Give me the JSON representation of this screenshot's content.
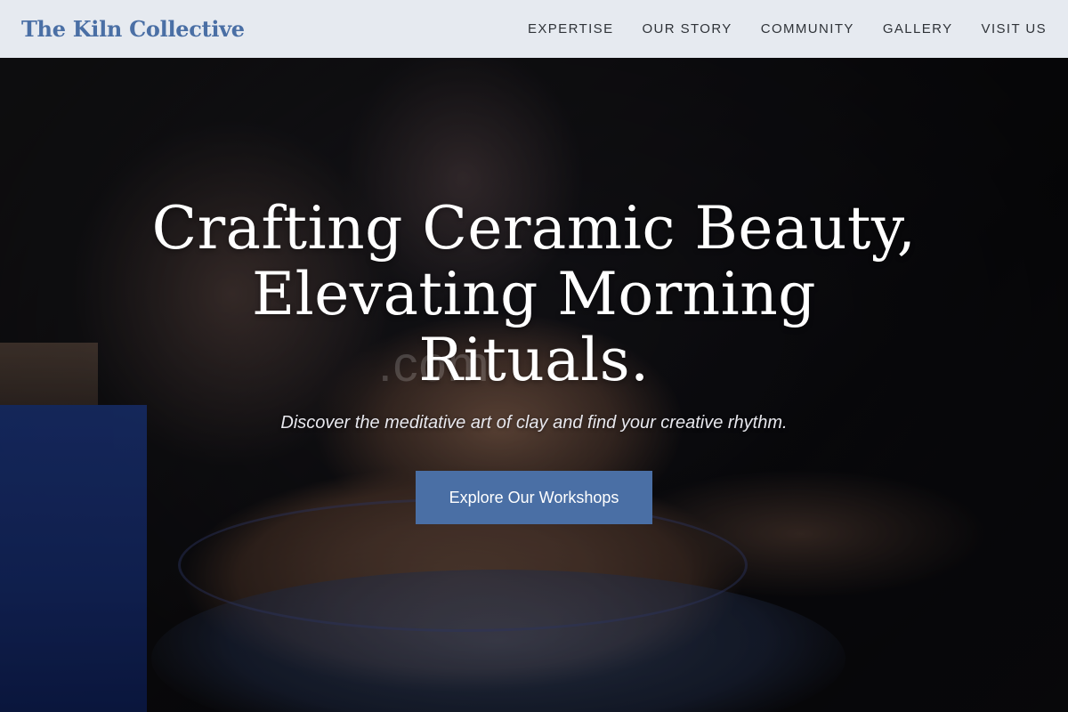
{
  "nav": {
    "brand": "The Kiln Collective",
    "links": [
      {
        "label": "EXPERTISE"
      },
      {
        "label": "OUR STORY"
      },
      {
        "label": "COMMUNITY"
      },
      {
        "label": "GALLERY"
      },
      {
        "label": "VISIT US"
      }
    ]
  },
  "hero": {
    "title_lines": [
      "Crafting Ceramic Beauty,",
      "Elevating Morning",
      "Rituals."
    ],
    "subtitle": "Discover the meditative art of clay and find your creative rhythm.",
    "cta_label": "Explore Our Workshops",
    "background_image": "pottery-wheel-hands-photo",
    "watermark": ".com"
  },
  "colors": {
    "brand": "#4a6fa5",
    "nav_bg": "#e6eaf0",
    "nav_text": "#2f3338",
    "hero_text": "#ffffff",
    "cta_bg": "#4a6fa5"
  }
}
